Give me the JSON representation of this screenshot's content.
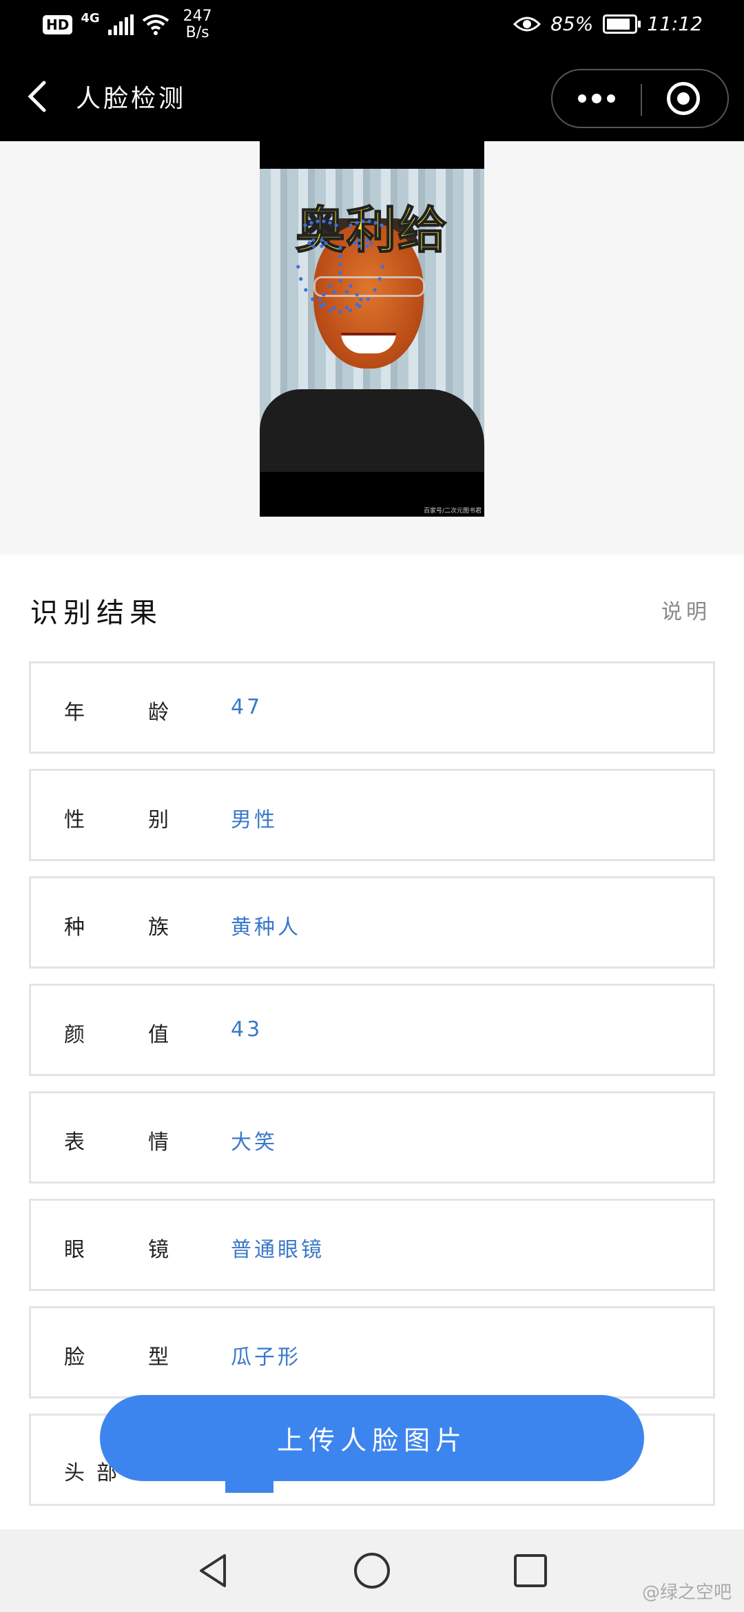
{
  "status_bar": {
    "hd": "HD",
    "network": "4G",
    "speed_value": "247",
    "speed_unit": "B/s",
    "battery": "85%",
    "time": "11:12"
  },
  "nav": {
    "title": "人脸检测"
  },
  "photo": {
    "caption": "奥利给",
    "credit": "百家号/二次元图书君"
  },
  "results": {
    "title": "识别结果",
    "help": "说明",
    "rows": [
      {
        "k1": "年",
        "k2": "龄",
        "value": "47"
      },
      {
        "k1": "性",
        "k2": "别",
        "value": "男性"
      },
      {
        "k1": "种",
        "k2": "族",
        "value": "黄种人"
      },
      {
        "k1": "颜",
        "k2": "值",
        "value": "43"
      },
      {
        "k1": "表",
        "k2": "情",
        "value": "大笑"
      },
      {
        "k1": "眼",
        "k2": "镜",
        "value": "普通眼镜"
      },
      {
        "k1": "脸",
        "k2": "型",
        "value": "瓜子形"
      },
      {
        "k1": "头",
        "k2": "部",
        "value": ""
      }
    ]
  },
  "upload_button": "上传人脸图片",
  "watermark": "@绿之空吧",
  "colors": {
    "accent": "#3d85ee",
    "value_text": "#3a78c9",
    "landmark_dots": "#3b6fe0"
  }
}
